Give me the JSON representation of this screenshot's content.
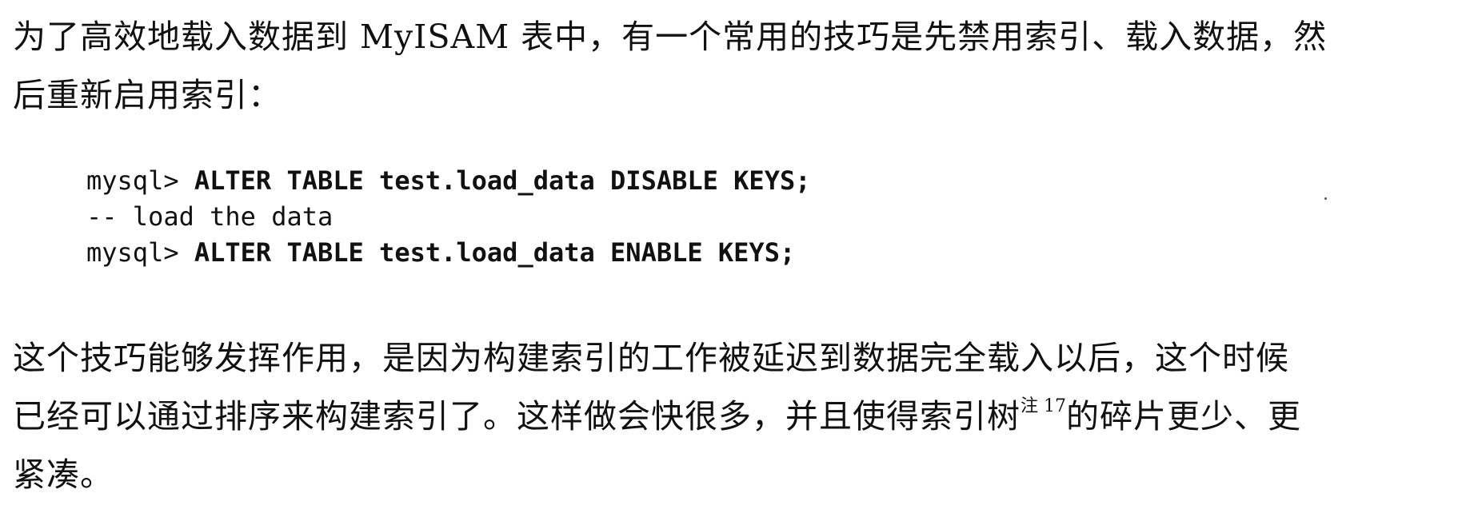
{
  "paragraph1": {
    "line1": "为了高效地载入数据到 MyISAM 表中，有一个常用的技巧是先禁用索引、载入数据，然",
    "line2": "后重新启用索引："
  },
  "code_block": {
    "line1_prompt": "mysql> ",
    "line1_command": "ALTER TABLE test.load_data DISABLE KEYS;",
    "line2_comment": "-- load the data",
    "line3_prompt": "mysql> ",
    "line3_command": "ALTER TABLE test.load_data ENABLE KEYS;"
  },
  "paragraph2": {
    "line1": "这个技巧能够发挥作用，是因为构建索引的工作被延迟到数据完全载入以后，这个时候",
    "line2_before_note": "已经可以通过排序来构建索引了。这样做会快很多，并且使得索引树",
    "footnote_marker": "注 17",
    "line2_after_note": "的碎片更少、更",
    "line3": "紧凑。"
  }
}
